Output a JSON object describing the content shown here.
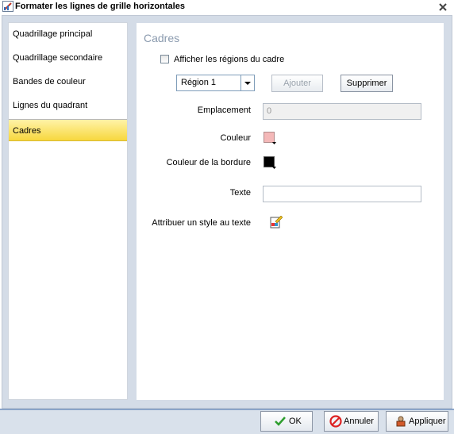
{
  "window": {
    "title": "Formater les lignes de grille horizontales",
    "app_icon": "chart-app-icon",
    "close_icon": "close-icon"
  },
  "nav": {
    "items": [
      {
        "label": "Quadrillage principal"
      },
      {
        "label": "Quadrillage secondaire"
      },
      {
        "label": "Bandes de couleur"
      },
      {
        "label": "Lignes du quadrant"
      },
      {
        "label": "Cadres"
      }
    ],
    "selected": "Cadres"
  },
  "panel": {
    "title": "Cadres",
    "show_regions_label": "Afficher les régions du cadre",
    "show_regions_checked": false,
    "region_select_value": "Région 1",
    "add_label": "Ajouter",
    "delete_label": "Supprimer",
    "location_label": "Emplacement",
    "location_value": "0",
    "color_label": "Couleur",
    "color_value": "#f4b8b8",
    "border_color_label": "Couleur de la bordure",
    "border_color_value": "#000000",
    "text_label": "Texte",
    "text_value": "",
    "style_text_label": "Attribuer un style au texte",
    "style_icon": "style-text-icon"
  },
  "footer": {
    "ok_label": "OK",
    "cancel_label": "Annuler",
    "apply_label": "Appliquer"
  }
}
